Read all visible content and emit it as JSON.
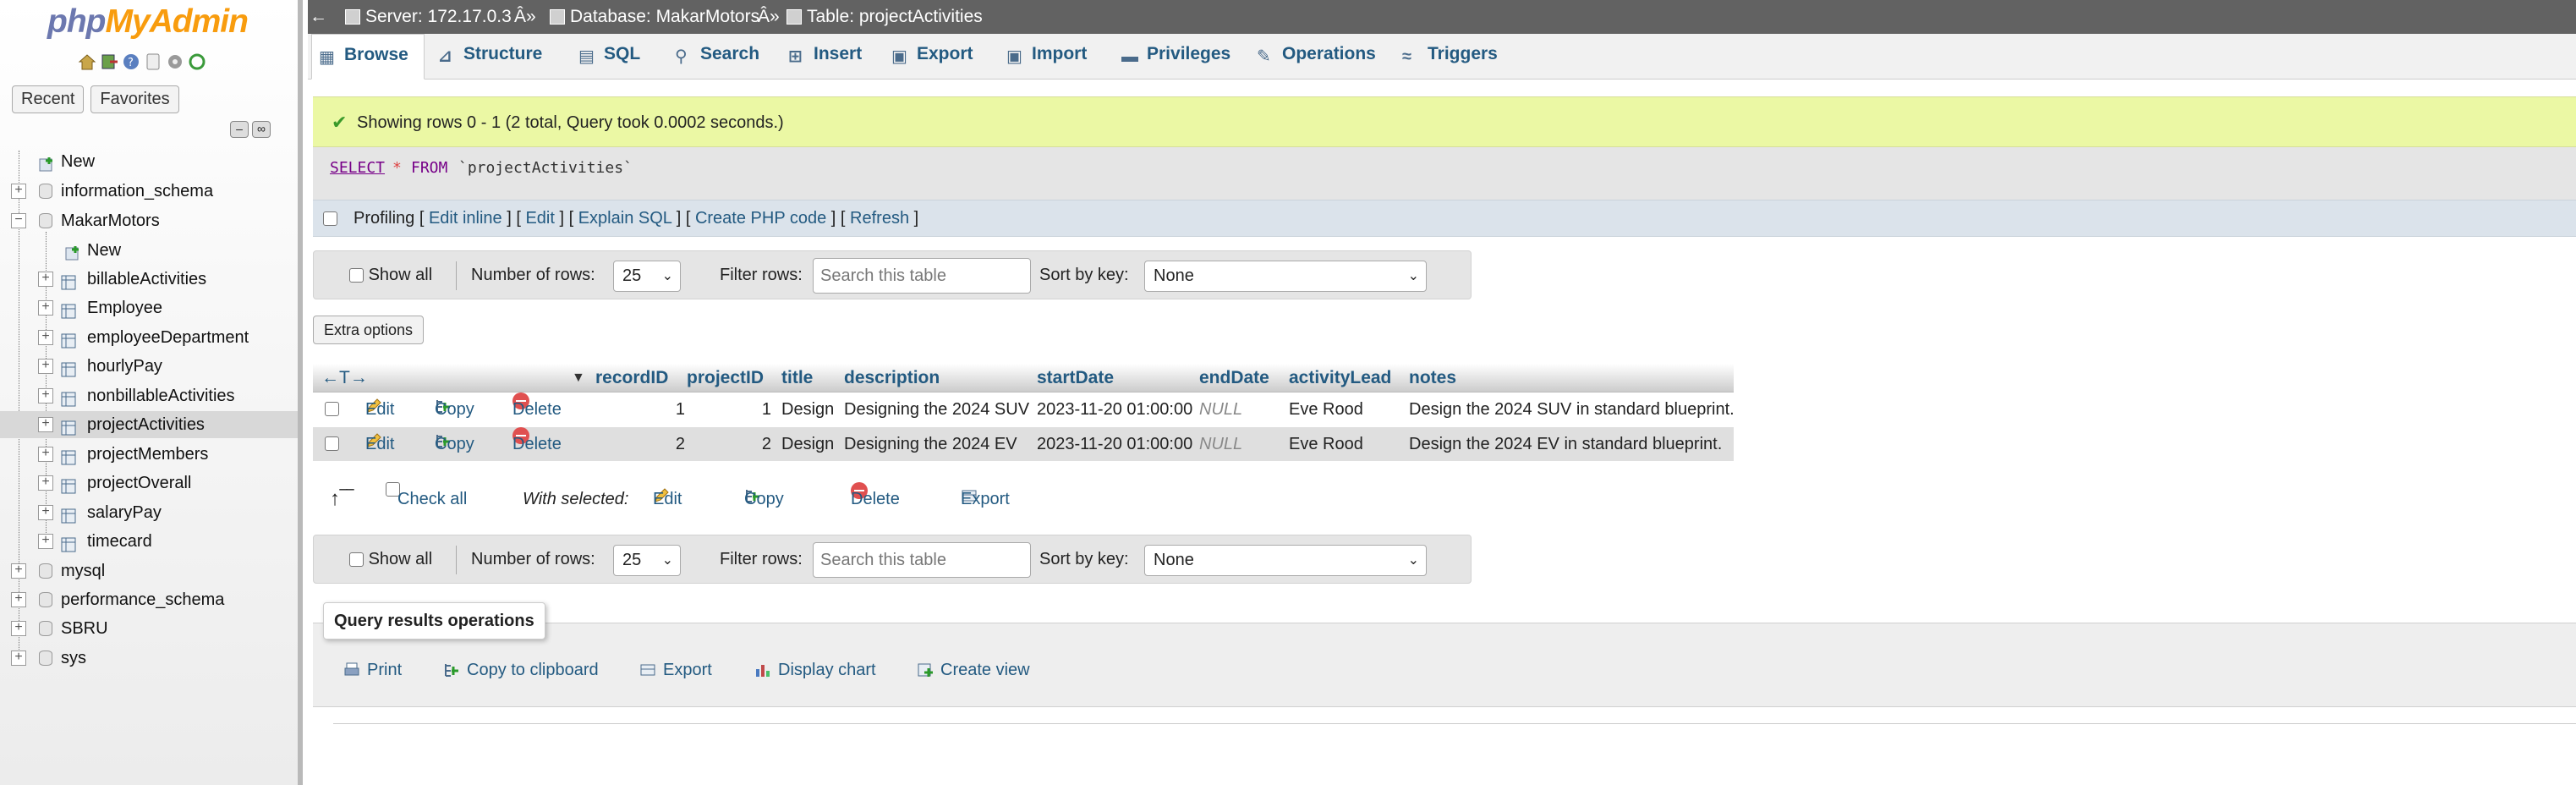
{
  "logo": {
    "php": "php",
    "myadmin": "MyAdmin"
  },
  "nav": {
    "tabs": [
      "Recent",
      "Favorites"
    ],
    "tree": {
      "new": "New",
      "databases": [
        "information_schema",
        "MakarMotors",
        "mysql",
        "performance_schema",
        "SBRU",
        "sys"
      ],
      "makar_new": "New",
      "tables": [
        "billableActivities",
        "Employee",
        "employeeDepartment",
        "hourlyPay",
        "nonbillableActivities",
        "projectActivities",
        "projectMembers",
        "projectOverall",
        "salaryPay",
        "timecard"
      ]
    }
  },
  "breadcrumb": {
    "server": "Server: 172.17.0.3",
    "sep1": "Â»",
    "database": "Database: MakarMotors",
    "sep2": "Â»",
    "table": "Table: projectActivities"
  },
  "tabs": [
    "Browse",
    "Structure",
    "SQL",
    "Search",
    "Insert",
    "Export",
    "Import",
    "Privileges",
    "Operations",
    "Triggers"
  ],
  "success_message": "Showing rows 0 - 1 (2 total, Query took 0.0002 seconds.)",
  "sql": {
    "select": "SELECT",
    "star": "*",
    "from": "FROM",
    "table": "`projectActivities`"
  },
  "profiling": {
    "label": "Profiling",
    "links": [
      "Edit inline",
      "Edit",
      "Explain SQL",
      "Create PHP code",
      "Refresh"
    ]
  },
  "nav_controls": {
    "show_all": "Show all",
    "num_rows_label": "Number of rows:",
    "num_rows_value": "25",
    "filter_label": "Filter rows:",
    "filter_placeholder": "Search this table",
    "sort_label": "Sort by key:",
    "sort_value": "None"
  },
  "extra_options": "Extra options",
  "table": {
    "columns": [
      "recordID",
      "projectID",
      "title",
      "description",
      "startDate",
      "endDate",
      "activityLead",
      "notes"
    ],
    "actions": {
      "edit": "Edit",
      "copy": "Copy",
      "delete": "Delete"
    },
    "rows": [
      {
        "recordID": "1",
        "projectID": "1",
        "title": "Design",
        "description": "Designing the 2024 SUV",
        "startDate": "2023-11-20 01:00:00",
        "endDate": "NULL",
        "activityLead": "Eve Rood",
        "notes": "Design the 2024 SUV in standard blueprint."
      },
      {
        "recordID": "2",
        "projectID": "2",
        "title": "Design",
        "description": "Designing the 2024 EV",
        "startDate": "2023-11-20 01:00:00",
        "endDate": "NULL",
        "activityLead": "Eve Rood",
        "notes": "Design the 2024 EV in standard blueprint."
      }
    ]
  },
  "with_selected": {
    "check_all": "Check all",
    "label": "With selected:",
    "edit": "Edit",
    "copy": "Copy",
    "delete": "Delete",
    "export": "Export"
  },
  "query_ops": {
    "legend": "Query results operations",
    "items": [
      "Print",
      "Copy to clipboard",
      "Export",
      "Display chart",
      "Create view"
    ]
  },
  "colors": {
    "link": "#235a81",
    "success_bg": "#ebf8a4",
    "topbar": "#626262"
  }
}
